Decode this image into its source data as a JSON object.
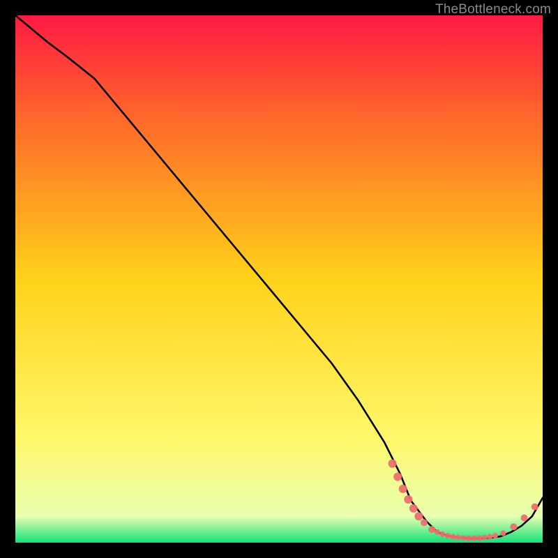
{
  "watermark": "TheBottleneck.com",
  "colors": {
    "frame": "#000000",
    "curve": "#000000",
    "marker_fill": "#ef6f6f",
    "marker_stroke": "#ef6f6f",
    "grad_top": "#ff1a44",
    "grad_mid1": "#ff6a2a",
    "grad_mid2": "#ffd21a",
    "grad_mid3": "#fff76a",
    "grad_mid4": "#e8ffb0",
    "grad_bottom": "#14e07a"
  },
  "chart_data": {
    "type": "line",
    "title": "",
    "xlabel": "",
    "ylabel": "",
    "xlim": [
      0,
      100
    ],
    "ylim": [
      0,
      100
    ],
    "series": [
      {
        "name": "curve",
        "x": [
          0,
          6,
          10,
          15,
          20,
          25,
          30,
          35,
          40,
          45,
          50,
          55,
          60,
          65,
          70,
          73,
          75,
          78,
          80,
          82,
          84,
          86,
          88,
          90,
          92,
          94,
          96,
          98,
          100
        ],
        "y": [
          100,
          95,
          92,
          88,
          82,
          76,
          70,
          64,
          58,
          52,
          46,
          40,
          34,
          27,
          19,
          13,
          8,
          4,
          2,
          1.3,
          1.0,
          0.8,
          0.8,
          0.9,
          1.2,
          2.0,
          3.2,
          5.0,
          8.5
        ]
      }
    ],
    "markers": [
      {
        "x": 71.5,
        "y": 15.0,
        "r": 6
      },
      {
        "x": 72.5,
        "y": 12.5,
        "r": 6
      },
      {
        "x": 73.5,
        "y": 10.2,
        "r": 6
      },
      {
        "x": 74.5,
        "y": 8.2,
        "r": 6
      },
      {
        "x": 75.5,
        "y": 6.5,
        "r": 6
      },
      {
        "x": 76.5,
        "y": 5.0,
        "r": 6
      },
      {
        "x": 77.5,
        "y": 3.8,
        "r": 5
      },
      {
        "x": 79.0,
        "y": 2.5,
        "r": 5
      },
      {
        "x": 80.0,
        "y": 2.0,
        "r": 4
      },
      {
        "x": 81.0,
        "y": 1.6,
        "r": 4
      },
      {
        "x": 82.0,
        "y": 1.3,
        "r": 4
      },
      {
        "x": 83.0,
        "y": 1.1,
        "r": 4
      },
      {
        "x": 84.0,
        "y": 1.0,
        "r": 4
      },
      {
        "x": 85.0,
        "y": 0.9,
        "r": 4
      },
      {
        "x": 86.0,
        "y": 0.85,
        "r": 4
      },
      {
        "x": 87.0,
        "y": 0.85,
        "r": 4
      },
      {
        "x": 88.0,
        "y": 0.9,
        "r": 4
      },
      {
        "x": 89.0,
        "y": 1.0,
        "r": 4
      },
      {
        "x": 90.0,
        "y": 1.1,
        "r": 4
      },
      {
        "x": 91.0,
        "y": 1.3,
        "r": 4
      },
      {
        "x": 92.5,
        "y": 1.8,
        "r": 4
      },
      {
        "x": 94.5,
        "y": 3.0,
        "r": 5
      },
      {
        "x": 96.5,
        "y": 4.7,
        "r": 5
      },
      {
        "x": 98.5,
        "y": 6.8,
        "r": 5
      }
    ],
    "gradient_bands": [
      {
        "y0": 100,
        "y1": 80,
        "c0": "grad_top",
        "c1": "grad_mid1"
      },
      {
        "y0": 80,
        "y1": 50,
        "c0": "grad_mid1",
        "c1": "grad_mid2"
      },
      {
        "y0": 50,
        "y1": 20,
        "c0": "grad_mid2",
        "c1": "grad_mid3"
      },
      {
        "y0": 20,
        "y1": 5,
        "c0": "grad_mid3",
        "c1": "grad_mid4"
      },
      {
        "y0": 5,
        "y1": 0,
        "c0": "grad_mid4",
        "c1": "grad_bottom"
      }
    ]
  }
}
